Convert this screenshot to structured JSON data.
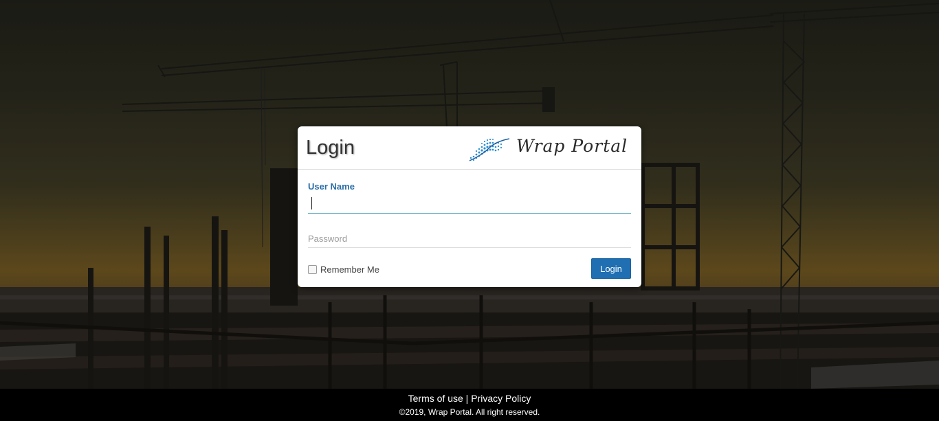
{
  "login": {
    "title": "Login",
    "brand_name": "Wrap Portal",
    "username_label": "User Name",
    "username_value": "",
    "password_placeholder": "Password",
    "remember_label": "Remember Me",
    "remember_checked": false,
    "submit_label": "Login"
  },
  "footer": {
    "terms_label": "Terms of use",
    "separator": "|",
    "privacy_label": "Privacy Policy",
    "copyright": "©2019, Wrap Portal. All right reserved."
  },
  "colors": {
    "accent": "#1f6fb2",
    "label_blue": "#2b6fa8",
    "footer_bg": "#000000"
  },
  "icons": {
    "brand_logo": "wave-grid-logo-icon"
  }
}
